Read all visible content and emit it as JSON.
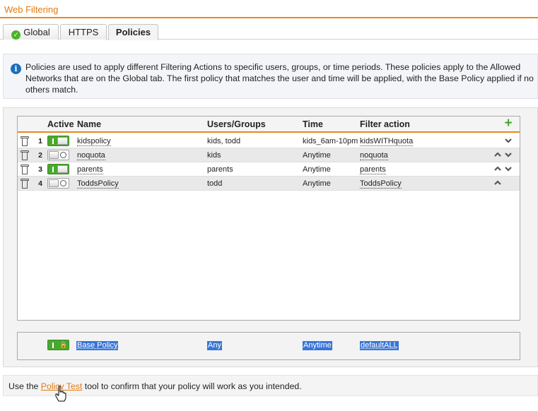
{
  "header": {
    "title": "Web Filtering"
  },
  "tabs": [
    {
      "label": "Global",
      "icon": "check-circle-icon",
      "active": false
    },
    {
      "label": "HTTPS",
      "active": false
    },
    {
      "label": "Policies",
      "active": true
    }
  ],
  "info": {
    "icon": "info-icon",
    "text": "Policies are used to apply different Filtering Actions to specific users, groups, or time periods. These policies apply to the Allowed Networks that are on the Global tab. The first policy that matches the user and time will be applied, with the Base Policy applied if no others match."
  },
  "grid": {
    "columns": [
      "Active",
      "Name",
      "Users/Groups",
      "Time",
      "Filter action"
    ],
    "add_icon": "plus-icon",
    "rows": [
      {
        "num": "1",
        "active": true,
        "name": "kidspolicy",
        "users": "kids, todd",
        "time": "kids_6am-10pm",
        "action": "kidsWITHquota",
        "arrows": [
          "down"
        ]
      },
      {
        "num": "2",
        "active": false,
        "name": "noquota",
        "users": "kids",
        "time": "Anytime",
        "action": "noquota",
        "arrows": [
          "up",
          "down"
        ]
      },
      {
        "num": "3",
        "active": true,
        "name": "parents",
        "users": "parents",
        "time": "Anytime",
        "action": "parents",
        "arrows": [
          "up",
          "down"
        ]
      },
      {
        "num": "4",
        "active": false,
        "name": "ToddsPolicy",
        "users": "todd",
        "time": "Anytime",
        "action": "ToddsPolicy",
        "arrows": [
          "up"
        ]
      }
    ]
  },
  "base_policy": {
    "name": "Base Policy",
    "users": "Any",
    "time": "Anytime",
    "action": "defaultALL",
    "active": true
  },
  "footer": {
    "prefix": "Use the ",
    "link": "Policy Test",
    "suffix": " tool to confirm that your policy will work as you intended."
  },
  "colors": {
    "accent": "#e8891f",
    "toggle_on": "#4aa82e",
    "selection": "#3875d7",
    "info": "#1a6fb8"
  }
}
